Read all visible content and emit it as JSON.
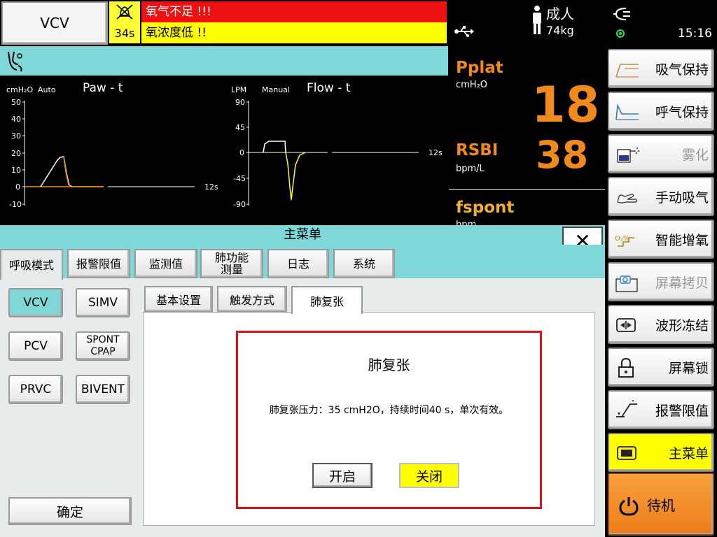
{
  "header": {
    "mode": "VCV",
    "alarm_timer": "34s",
    "alarm_high": "氧气不足 !!!",
    "alarm_medium": "氧浓度低 !!",
    "patient_type": "成人",
    "patient_weight": "74kg",
    "clock": "15:16"
  },
  "waveforms": {
    "paw": {
      "unit": "cmH₂O",
      "scale_mode": "Auto",
      "title": "Paw - t",
      "y_ticks": [
        "50",
        "40",
        "30",
        "20",
        "10",
        "0",
        "-10"
      ],
      "x_end": "12s"
    },
    "flow": {
      "unit": "LPM",
      "scale_mode": "Manual",
      "title": "Flow - t",
      "y_ticks": [
        "90",
        "45",
        "0",
        "-45",
        "-90"
      ],
      "x_end": "12s"
    },
    "colors": {
      "trace": "#ffffff",
      "inspiration": "#f08a1c",
      "expiration": "#ffff33"
    }
  },
  "values": {
    "pplat": {
      "name": "Pplat",
      "unit": "cmH₂O",
      "value": "18"
    },
    "rsbi": {
      "name": "RSBI",
      "unit": "bpm/L",
      "value": "38"
    },
    "fspont": {
      "name": "fspont",
      "unit": "bpm"
    }
  },
  "sidebar": {
    "insp_hold": "吸气保持",
    "exp_hold": "呼气保持",
    "nebulizer": "雾化",
    "manual_breath": "手动吸气",
    "o2_boost": "智能增氧",
    "screenshot": "屏幕拷贝",
    "freeze": "波形冻结",
    "lock": "屏幕锁",
    "alarm_limits": "报警限值",
    "main_menu": "主菜单",
    "standby": "待机"
  },
  "menu": {
    "title": "主菜单",
    "close": "✕",
    "tabs": [
      "呼吸模式",
      "报警限值",
      "监测值",
      "肺功能\n测量",
      "日志",
      "系统"
    ],
    "modes": [
      "VCV",
      "SIMV",
      "PCV",
      "SPONT\nCPAP",
      "PRVC",
      "BIVENT"
    ],
    "confirm": "确定",
    "subtabs": [
      "基本设置",
      "触发方式",
      "肺复张"
    ],
    "recruitment": {
      "title": "肺复张",
      "description": "肺复张压力：35 cmH2O，持续时间40 s，单次有效。",
      "on": "开启",
      "off": "关闭"
    }
  },
  "colors": {
    "accent_teal": "#7fd7d7",
    "value_orange": "#f08a1c",
    "alarm_red": "#ee1111",
    "alarm_yellow": "#ffff00",
    "standby_orange": "#ee7d1a"
  }
}
